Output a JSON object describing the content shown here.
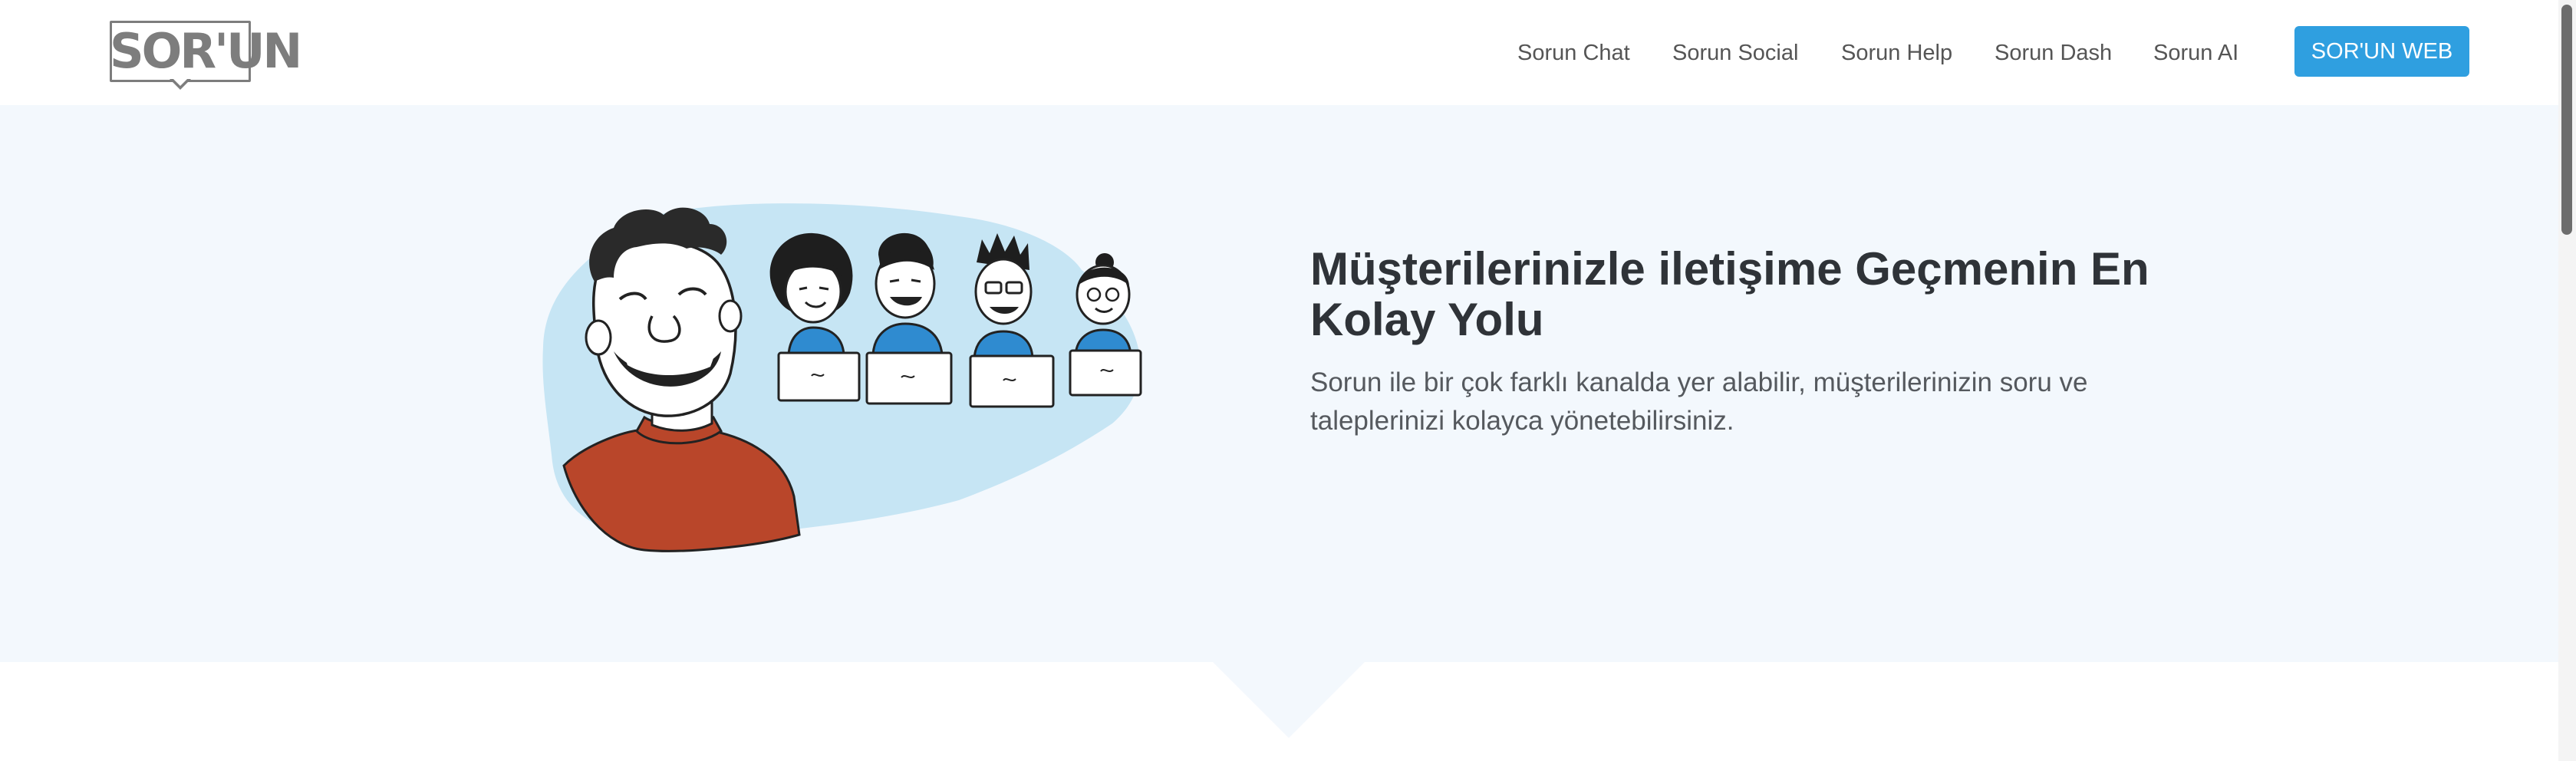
{
  "header": {
    "logo_text": "SOR'UN",
    "nav": [
      {
        "label": "Sorun Chat"
      },
      {
        "label": "Sorun Social"
      },
      {
        "label": "Sorun Help"
      },
      {
        "label": "Sorun Dash"
      },
      {
        "label": "Sorun AI"
      }
    ],
    "cta_label": "SOR'UN WEB"
  },
  "hero": {
    "title": "Müşterilerinizle iletişime Geçmenin En Kolay Yolu",
    "subtitle": "Sorun ile bir çok farklı kanalda yer alabilir, müşterilerinizin soru ve taleplerinizi kolayca yönetebilirsiniz."
  },
  "colors": {
    "accent": "#2f9fe0",
    "hero_background": "#f3f8fd",
    "illustration_blob": "#c6e5f4",
    "sweater": "#b9462a"
  },
  "icons": {
    "illustration": "customer-support-team-illustration"
  }
}
